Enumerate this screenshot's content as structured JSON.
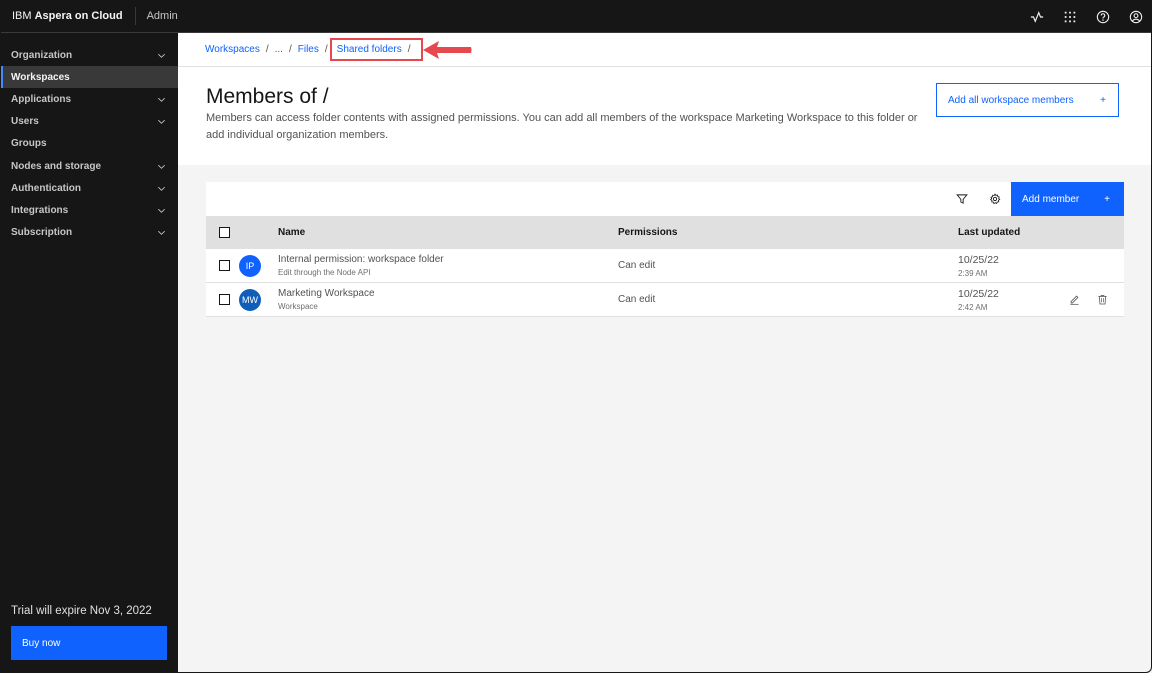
{
  "header": {
    "brand_prefix": "IBM",
    "brand_name": "Aspera on Cloud",
    "section": "Admin",
    "icons": [
      "activity-icon",
      "app-switcher-icon",
      "help-icon",
      "user-profile-icon"
    ]
  },
  "sidebar": {
    "items": [
      {
        "label": "Organization",
        "expandable": true,
        "active": false
      },
      {
        "label": "Workspaces",
        "expandable": false,
        "active": true
      },
      {
        "label": "Applications",
        "expandable": true,
        "active": false
      },
      {
        "label": "Users",
        "expandable": true,
        "active": false
      },
      {
        "label": "Groups",
        "expandable": false,
        "active": false
      },
      {
        "label": "Nodes and storage",
        "expandable": true,
        "active": false
      },
      {
        "label": "Authentication",
        "expandable": true,
        "active": false
      },
      {
        "label": "Integrations",
        "expandable": true,
        "active": false
      },
      {
        "label": "Subscription",
        "expandable": true,
        "active": false
      }
    ],
    "trial_text": "Trial will expire Nov 3, 2022",
    "buy_label": "Buy now"
  },
  "breadcrumb": {
    "items": [
      "Workspaces",
      "...",
      "Files",
      "Shared folders"
    ],
    "separator": "/",
    "highlighted": "Shared folders"
  },
  "page": {
    "title": "Members of /",
    "description": "Members can access folder contents with assigned permissions. You can add all members of the workspace Marketing Workspace to this folder or add individual organization members.",
    "add_all_label": "Add all workspace members",
    "add_all_icon": "+"
  },
  "table": {
    "toolbar": {
      "filter_icon": "filter-icon",
      "settings_icon": "settings-icon",
      "add_member_label": "Add member",
      "add_member_icon": "+"
    },
    "columns": [
      "Name",
      "Permissions",
      "Last updated"
    ],
    "rows": [
      {
        "initials": "IP",
        "avatar_color": "#0f62fe",
        "name": "Internal permission: workspace folder",
        "subtitle": "Edit through the Node API",
        "permission": "Can edit",
        "date": "10/25/22",
        "time": "2:39 AM",
        "actions": false
      },
      {
        "initials": "MW",
        "avatar_color": "#0f5fba",
        "name": "Marketing Workspace",
        "subtitle": "Workspace",
        "permission": "Can edit",
        "date": "10/25/22",
        "time": "2:42 AM",
        "actions": true
      }
    ]
  },
  "colors": {
    "accent": "#0f62fe",
    "highlight_annotation": "#e5484d"
  }
}
